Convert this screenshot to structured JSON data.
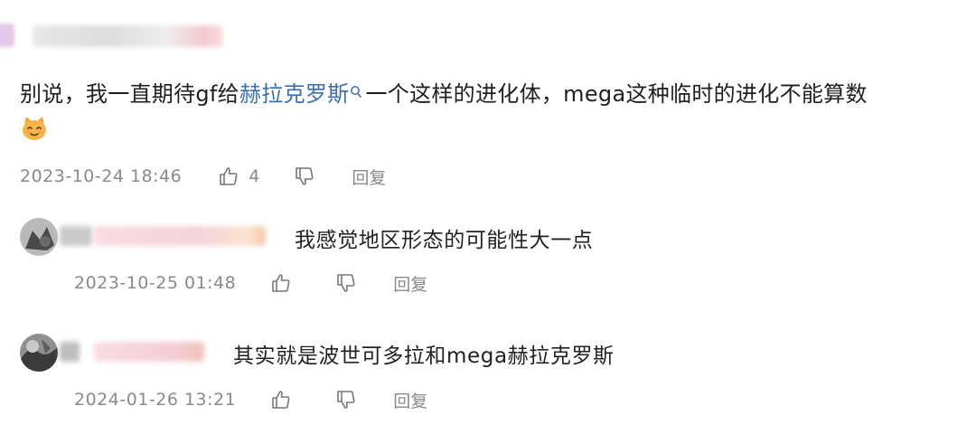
{
  "main_comment": {
    "text_before": "别说，我一直期待gf给",
    "link_text": "赫拉克罗斯",
    "text_after": "一个这样的进化体，mega这种临时的进化不能算数",
    "emoji": "cat-face-emoji",
    "timestamp": "2023-10-24 18:46",
    "like_count": "4",
    "reply_label": "回复"
  },
  "replies": [
    {
      "text": "我感觉地区形态的可能性大一点",
      "timestamp": "2023-10-25 01:48",
      "reply_label": "回复"
    },
    {
      "text": "其实就是波世可多拉和mega赫拉克罗斯",
      "timestamp": "2024-01-26 13:21",
      "reply_label": "回复"
    }
  ],
  "icons": {
    "like": "thumbs-up-icon",
    "dislike": "thumbs-down-icon",
    "search": "search-icon"
  },
  "colors": {
    "link": "#3a6fb4",
    "meta": "#8a8a8a",
    "blur_pink": "#f6c9d3"
  }
}
